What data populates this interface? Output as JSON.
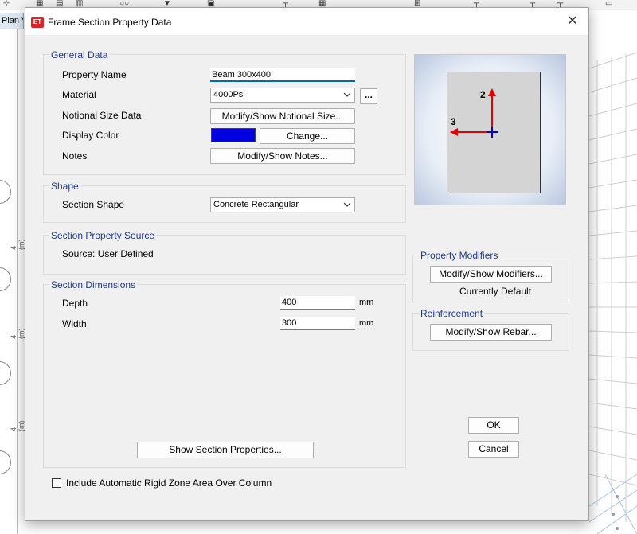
{
  "background": {
    "tab_label": "Plan Vi",
    "dim_label": "4 (m)"
  },
  "dialog": {
    "title": "Frame Section Property Data",
    "app_icon_text": "ET",
    "close_glyph": "✕",
    "general_data": {
      "title": "General Data",
      "property_name_label": "Property Name",
      "property_name_value": "Beam 300x400",
      "material_label": "Material",
      "material_value": "4000Psi",
      "material_more": "...",
      "notional_label": "Notional Size Data",
      "notional_button": "Modify/Show Notional Size...",
      "display_color_label": "Display Color",
      "display_color_value": "#0000e0",
      "change_button": "Change...",
      "notes_label": "Notes",
      "notes_button": "Modify/Show Notes..."
    },
    "shape": {
      "title": "Shape",
      "section_shape_label": "Section Shape",
      "section_shape_value": "Concrete Rectangular"
    },
    "source": {
      "title": "Section Property Source",
      "source_text": "Source:  User Defined"
    },
    "dimensions": {
      "title": "Section Dimensions",
      "depth_label": "Depth",
      "depth_value": "400",
      "depth_unit": "mm",
      "width_label": "Width",
      "width_value": "300",
      "width_unit": "mm",
      "show_props_button": "Show Section Properties..."
    },
    "preview": {
      "axis_2": "2",
      "axis_3": "3",
      "axis_color": "#e00000",
      "origin_color": "#0000cc"
    },
    "modifiers": {
      "title": "Property Modifiers",
      "button": "Modify/Show Modifiers...",
      "status": "Currently Default"
    },
    "reinforcement": {
      "title": "Reinforcement",
      "button": "Modify/Show Rebar..."
    },
    "ok_button": "OK",
    "cancel_button": "Cancel",
    "rigid_zone_label": "Include Automatic Rigid Zone Area Over Column",
    "rigid_zone_checked": false
  }
}
